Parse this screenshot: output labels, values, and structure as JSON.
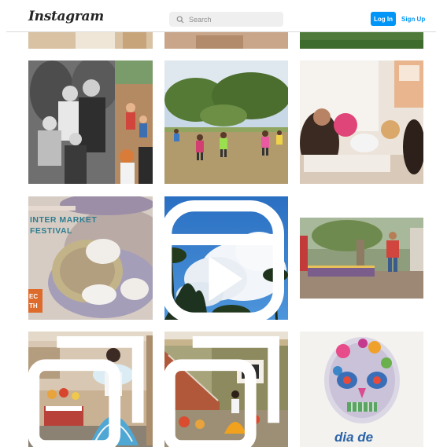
{
  "header": {
    "logo": "Instagram",
    "search_placeholder": "Search",
    "login_label": "Log In",
    "signup_label": "Sign Up"
  },
  "posts": {
    "p1": {
      "overlay": "INTER MARKET\nFESTIVAL",
      "date": "EC\nTH"
    },
    "p2": {
      "overlay": "dia de"
    }
  },
  "colors": {
    "accent": "#0095f6",
    "text": "#262626",
    "border": "#dbdbdb"
  }
}
